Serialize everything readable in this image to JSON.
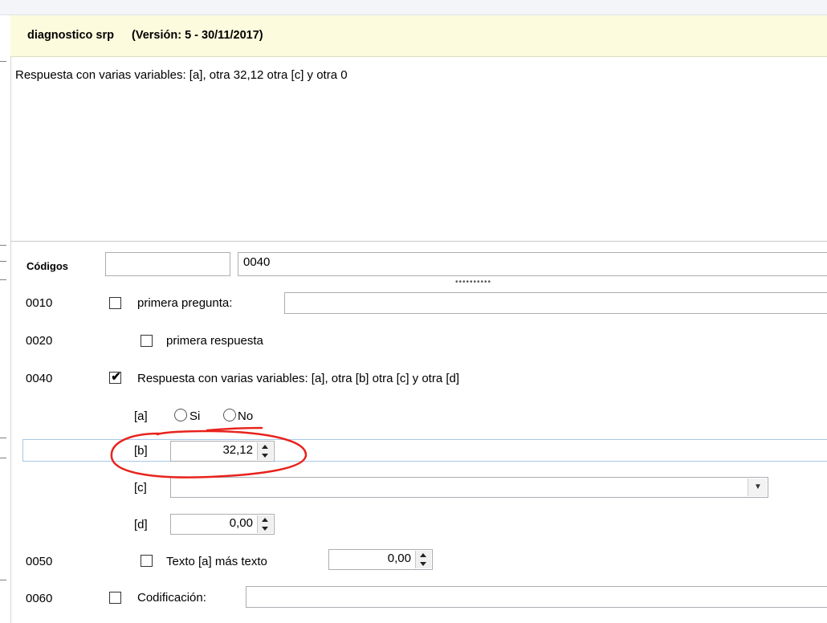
{
  "header": {
    "title": "diagnostico srp",
    "version": "(Versión: 5 - 30/11/2017)"
  },
  "description": "Respuesta con varias variables: [a], otra 32,12 otra [c] y otra 0",
  "codes": {
    "label": "Códigos",
    "input1_value": "",
    "input2_value": "0040"
  },
  "rows": {
    "r0010": {
      "code": "0010",
      "label": "primera pregunta:",
      "checked": false
    },
    "r0020": {
      "code": "0020",
      "label": "primera respuesta",
      "checked": false
    },
    "r0040": {
      "code": "0040",
      "label": "Respuesta con varias variables: [a], otra [b] otra [c] y otra [d]",
      "checked": true,
      "check_glyph": "✔"
    },
    "var_a": {
      "label": "[a]",
      "option_si": "Si",
      "option_no": "No"
    },
    "var_b": {
      "label": "[b]",
      "value": "32,12"
    },
    "var_c": {
      "label": "[c]",
      "value": ""
    },
    "var_d": {
      "label": "[d]",
      "value": "0,00"
    },
    "r0050": {
      "code": "0050",
      "label": "Texto [a] más texto",
      "value": "0,00",
      "checked": false
    },
    "r0060": {
      "code": "0060",
      "label": "Codificación:",
      "checked": false
    }
  },
  "annotation": {
    "color": "#e8231d"
  },
  "colors": {
    "header_bg": "#fdfbde",
    "highlight_border": "#a9c7e6"
  }
}
